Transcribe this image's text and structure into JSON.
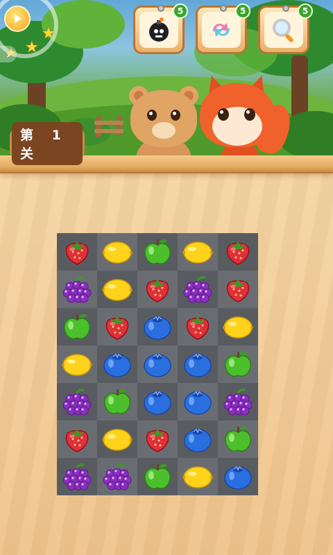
{
  "hud": {
    "play_icon": "play-icon",
    "stars": [
      "star",
      "star",
      "star"
    ],
    "side_icon": "chevron-right-icon",
    "boosters": [
      {
        "name": "bomb",
        "icon": "bomb-icon",
        "count": "5"
      },
      {
        "name": "swap",
        "icon": "swap-icon",
        "count": "5"
      },
      {
        "name": "magnifier",
        "icon": "magnifier-icon",
        "count": "5"
      }
    ]
  },
  "level": {
    "label": "第 1 关"
  },
  "board": {
    "rows": [
      [
        "strawberry",
        "lemon",
        "apple",
        "lemon",
        "strawberry"
      ],
      [
        "grape",
        "lemon",
        "strawberry",
        "grape",
        "strawberry"
      ],
      [
        "apple",
        "strawberry",
        "blueberry",
        "strawberry",
        "lemon"
      ],
      [
        "lemon",
        "blueberry",
        "blueberry",
        "blueberry",
        "apple"
      ],
      [
        "grape",
        "apple",
        "blueberry",
        "blueberry",
        "grape"
      ],
      [
        "strawberry",
        "lemon",
        "strawberry",
        "blueberry",
        "apple"
      ],
      [
        "grape",
        "grape",
        "apple",
        "lemon",
        "blueberry"
      ]
    ]
  },
  "colors": {
    "strawberry": "#e0303a",
    "lemon": "#ffd21c",
    "apple": "#4cbf2c",
    "grape": "#8a2fbf",
    "blueberry": "#2a6fe0",
    "booster_badge": "#3aa52d"
  }
}
